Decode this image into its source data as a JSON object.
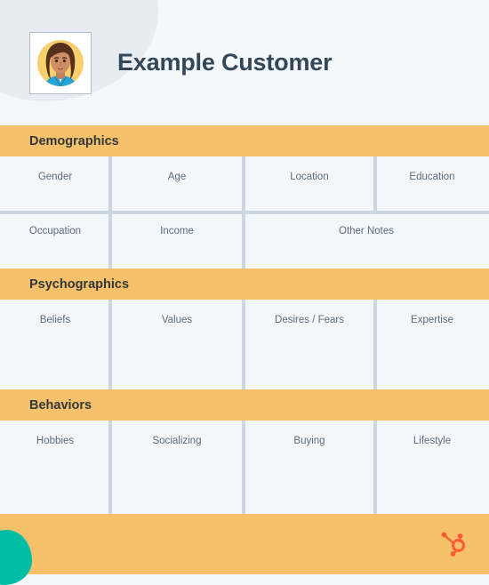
{
  "header": {
    "title": "Example Customer",
    "avatar_alt": "customer-avatar"
  },
  "colors": {
    "page_background": "#f5f8fa",
    "band_orange": "#f5c26b",
    "cell_background": "#f4f7f9",
    "divider": "#ccd6e0",
    "title_navy": "#33475b",
    "label_gray": "#5b6b7c",
    "blob_lavender": "#e8ebf2",
    "blob_teal": "#00bda5",
    "logo_orange": "#ff5c35"
  },
  "sections": [
    {
      "title": "Demographics",
      "rows": [
        {
          "cells": [
            {
              "label": "Gender",
              "span": 1
            },
            {
              "label": "Age",
              "span": 1
            },
            {
              "label": "Location",
              "span": 1
            },
            {
              "label": "Education",
              "span": 1
            }
          ]
        },
        {
          "cells": [
            {
              "label": "Occupation",
              "span": 1
            },
            {
              "label": "Income",
              "span": 1
            },
            {
              "label": "Other Notes",
              "span": 2
            }
          ]
        }
      ]
    },
    {
      "title": "Psychographics",
      "rows": [
        {
          "cells": [
            {
              "label": "Beliefs",
              "span": 1
            },
            {
              "label": "Values",
              "span": 1
            },
            {
              "label": "Desires / Fears",
              "span": 1
            },
            {
              "label": "Expertise",
              "span": 1
            }
          ]
        }
      ]
    },
    {
      "title": "Behaviors",
      "rows": [
        {
          "cells": [
            {
              "label": "Hobbies",
              "span": 1
            },
            {
              "label": "Socializing",
              "span": 1
            },
            {
              "label": "Buying",
              "span": 1
            },
            {
              "label": "Lifestyle",
              "span": 1
            }
          ]
        }
      ]
    }
  ],
  "footer": {
    "logo_name": "hubspot-sprocket-logo"
  }
}
